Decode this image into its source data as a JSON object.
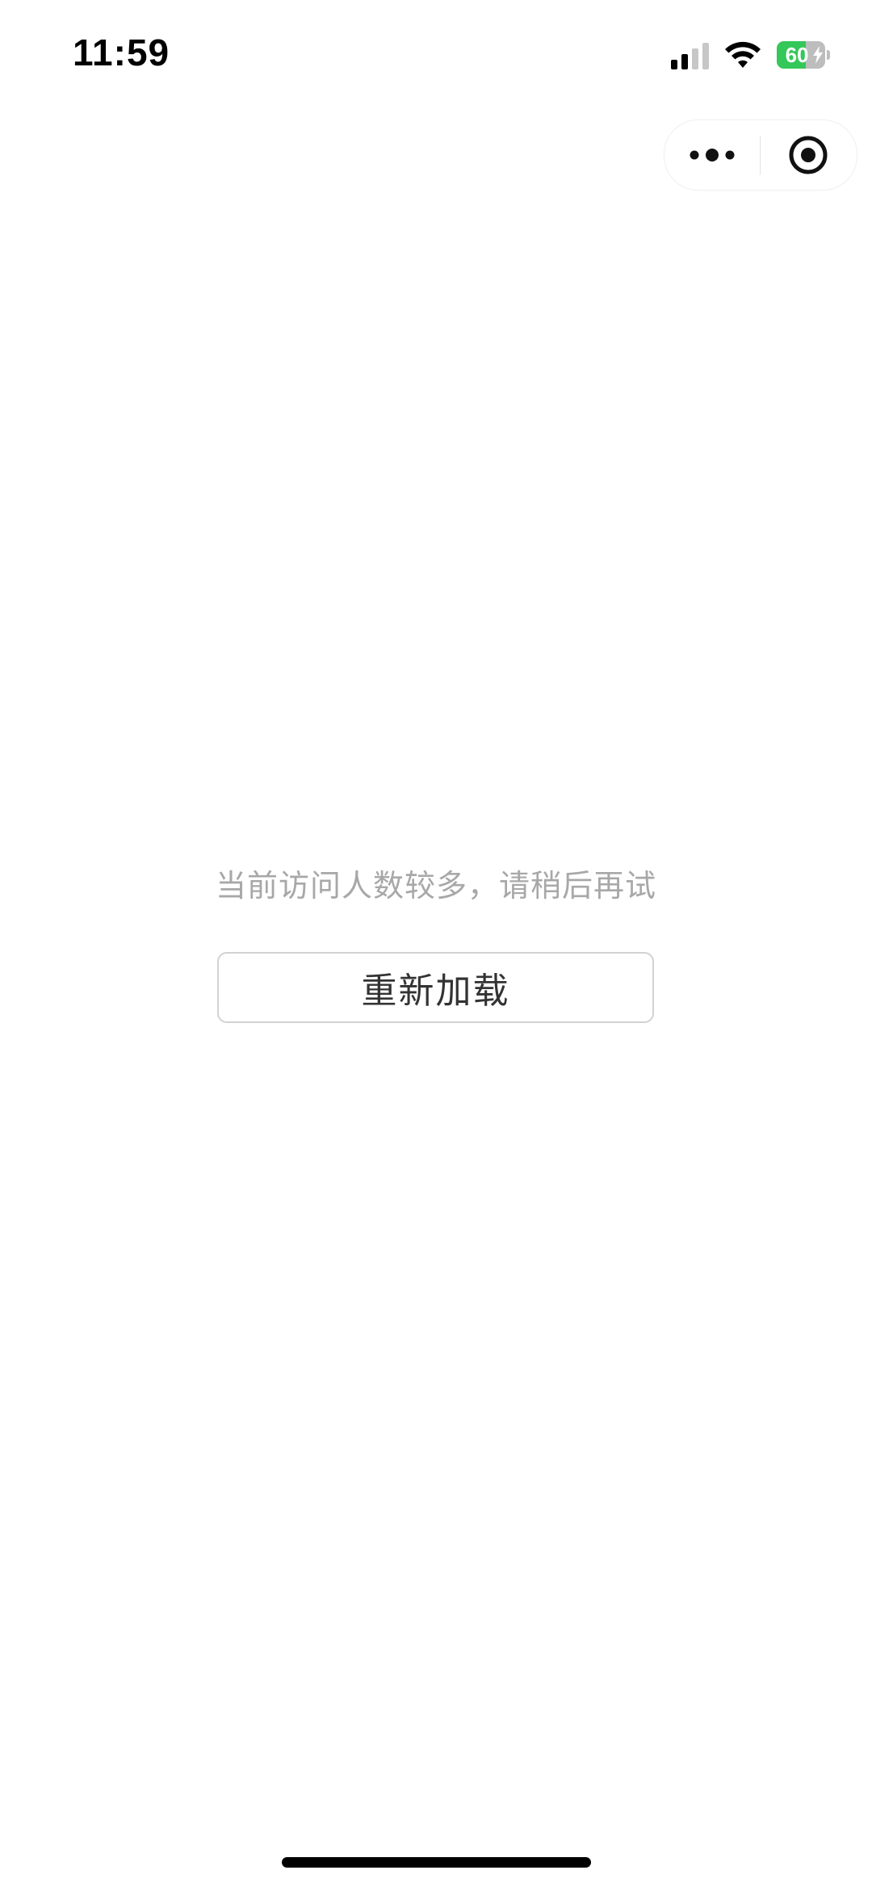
{
  "status_bar": {
    "time": "11:59",
    "battery_percent": "60",
    "battery_level": 0.6,
    "signal_bars_active": 2,
    "signal_bars_total": 4,
    "icons": [
      "cellular-signal-icon",
      "wifi-icon",
      "battery-charging-icon"
    ]
  },
  "capsule": {
    "icons": [
      "more-dots-icon",
      "close-target-icon"
    ]
  },
  "main": {
    "message": "当前访问人数较多，请稍后再试",
    "reload_label": "重新加载"
  },
  "colors": {
    "battery_fill": "#34c759",
    "message_text": "#a8a8a8",
    "button_border": "#d2d2d2"
  }
}
